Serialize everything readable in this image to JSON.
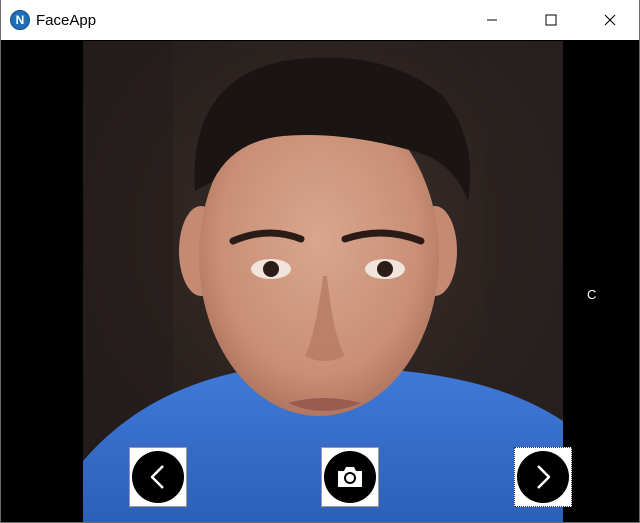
{
  "window": {
    "title": "FaceApp",
    "icon_letter": "N",
    "icon_color": "#1f6fb8"
  },
  "side_label": "C",
  "controls": {
    "prev_icon": "chevron-left-icon",
    "capture_icon": "camera-icon",
    "next_icon": "chevron-right-icon"
  },
  "colors": {
    "window_background": "#000000",
    "titlebar": "#ffffff",
    "shirt": "#3a6fd0"
  }
}
